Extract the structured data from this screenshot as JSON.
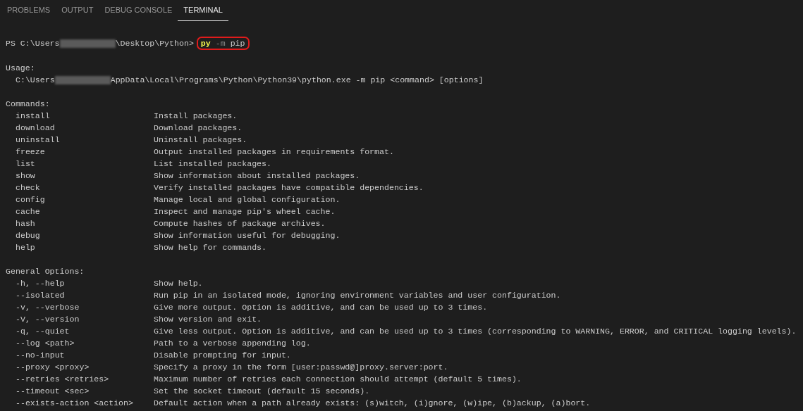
{
  "tabs": [
    {
      "label": "PROBLEMS",
      "selected": false
    },
    {
      "label": "OUTPUT",
      "selected": false
    },
    {
      "label": "DEBUG CONSOLE",
      "selected": false
    },
    {
      "label": "TERMINAL",
      "selected": true
    }
  ],
  "prompt": {
    "before_redaction": "PS C:\\Users",
    "after_redaction": "\\Desktop\\Python>",
    "command": {
      "program": "py",
      "flag": "-m",
      "argument": "pip"
    }
  },
  "usage": {
    "heading": "Usage:",
    "before_redaction": "C:\\Users",
    "after_redaction": "AppData\\Local\\Programs\\Python\\Python39\\python.exe -m pip <command> [options]"
  },
  "sections": [
    {
      "heading": "Commands:",
      "rows": [
        {
          "name": "install",
          "description": "Install packages."
        },
        {
          "name": "download",
          "description": "Download packages."
        },
        {
          "name": "uninstall",
          "description": "Uninstall packages."
        },
        {
          "name": "freeze",
          "description": "Output installed packages in requirements format."
        },
        {
          "name": "list",
          "description": "List installed packages."
        },
        {
          "name": "show",
          "description": "Show information about installed packages."
        },
        {
          "name": "check",
          "description": "Verify installed packages have compatible dependencies."
        },
        {
          "name": "config",
          "description": "Manage local and global configuration."
        },
        {
          "name": "cache",
          "description": "Inspect and manage pip's wheel cache."
        },
        {
          "name": "hash",
          "description": "Compute hashes of package archives."
        },
        {
          "name": "debug",
          "description": "Show information useful for debugging."
        },
        {
          "name": "help",
          "description": "Show help for commands."
        }
      ]
    },
    {
      "heading": "General Options:",
      "rows": [
        {
          "name": "-h, --help",
          "description": "Show help."
        },
        {
          "name": "--isolated",
          "description": "Run pip in an isolated mode, ignoring environment variables and user configuration."
        },
        {
          "name": "-v, --verbose",
          "description": "Give more output. Option is additive, and can be used up to 3 times."
        },
        {
          "name": "-V, --version",
          "description": "Show version and exit."
        },
        {
          "name": "-q, --quiet",
          "description": "Give less output. Option is additive, and can be used up to 3 times (corresponding to WARNING, ERROR, and CRITICAL logging levels)."
        },
        {
          "name": "--log <path>",
          "description": "Path to a verbose appending log."
        },
        {
          "name": "--no-input",
          "description": "Disable prompting for input."
        },
        {
          "name": "--proxy <proxy>",
          "description": "Specify a proxy in the form [user:passwd@]proxy.server:port."
        },
        {
          "name": "--retries <retries>",
          "description": "Maximum number of retries each connection should attempt (default 5 times)."
        },
        {
          "name": "--timeout <sec>",
          "description": "Set the socket timeout (default 15 seconds)."
        },
        {
          "name": "--exists-action <action>",
          "description": "Default action when a path already exists: (s)witch, (i)gnore, (w)ipe, (b)ackup, (a)bort."
        }
      ]
    }
  ]
}
